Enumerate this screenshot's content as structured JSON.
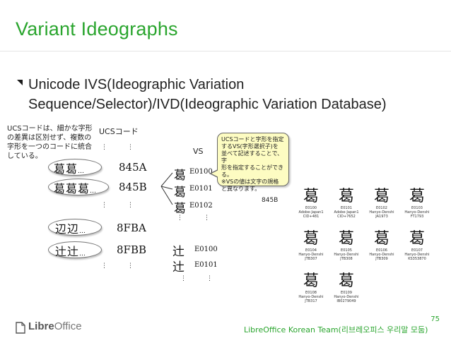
{
  "slide": {
    "title": "Variant Ideographs",
    "bullet_line1": "Unicode IVS(Ideographic Variation",
    "bullet_line2": "Sequence/Selector)/IVD(Ideographic Variation Database)",
    "slide_number": "75",
    "footer": "LibreOffice Korean Team(리브레오피스 우리말 모둠)",
    "logo": {
      "word_bold": "Libre",
      "word_light": "Office"
    }
  },
  "diagram": {
    "jp_note": [
      "UCSコードは、細かな字形",
      "の差異は区別せず、複数の",
      "字形を一つのコードに統合",
      "している。"
    ],
    "ucs_header": "UCSコード",
    "vs_header": "VS",
    "ellipsis": "…",
    "vertical_dots": "⋮",
    "rows": [
      {
        "glyphs": "葛葛",
        "code": "845A"
      },
      {
        "glyphs": "葛葛葛",
        "code": "845B"
      },
      {
        "glyphs": "辺辺",
        "code": "8FBA"
      },
      {
        "glyphs": "辻辻",
        "code": "8FBB"
      }
    ],
    "vs_glyph_845b": "葛",
    "vs_glyph_8fbb": "辻",
    "vs_codes_845b": [
      "E0100",
      "E0101",
      "E0102"
    ],
    "vs_codes_8fbb": [
      "E0100",
      "E0101"
    ],
    "callout": [
      "UCSコードと字形を指定",
      "するVS(字形選択子)を",
      "並べて記述することで、字",
      "形を指定することができる。",
      "※VSの値は文字の規格",
      "と異なります。"
    ],
    "gallery_label": "845B",
    "gallery": [
      {
        "glyph": "葛",
        "code": "E0100",
        "collection": "Adobe-Japan1",
        "id": "CID+481"
      },
      {
        "glyph": "葛",
        "code": "E0101",
        "collection": "Adobe-Japan1",
        "id": "CID+7652"
      },
      {
        "glyph": "葛",
        "code": "E0102",
        "collection": "Hanyo-Denshi",
        "id": "JA1973"
      },
      {
        "glyph": "葛",
        "code": "E0103",
        "collection": "Hanyo-Denshi",
        "id": "FT1793"
      },
      {
        "glyph": "葛",
        "code": "E0104",
        "collection": "Hanyo-Denshi",
        "id": "JTB307"
      },
      {
        "glyph": "葛",
        "code": "E0105",
        "collection": "Hanyo-Denshi",
        "id": "JTB308"
      },
      {
        "glyph": "葛",
        "code": "E0106",
        "collection": "Hanyo-Denshi",
        "id": "JTB309"
      },
      {
        "glyph": "葛",
        "code": "E0107",
        "collection": "Hanyo-Denshi",
        "id": "KS353870"
      },
      {
        "glyph": "葛",
        "code": "E0108",
        "collection": "Hanyo-Denshi",
        "id": "JTB317"
      },
      {
        "glyph": "葛",
        "code": "E0109",
        "collection": "Hanyo-Denshi",
        "id": "IB0279049"
      }
    ]
  },
  "colors": {
    "accent": "#2aa52e",
    "callout_bg": "#fdfcc2",
    "text": "#222222"
  }
}
